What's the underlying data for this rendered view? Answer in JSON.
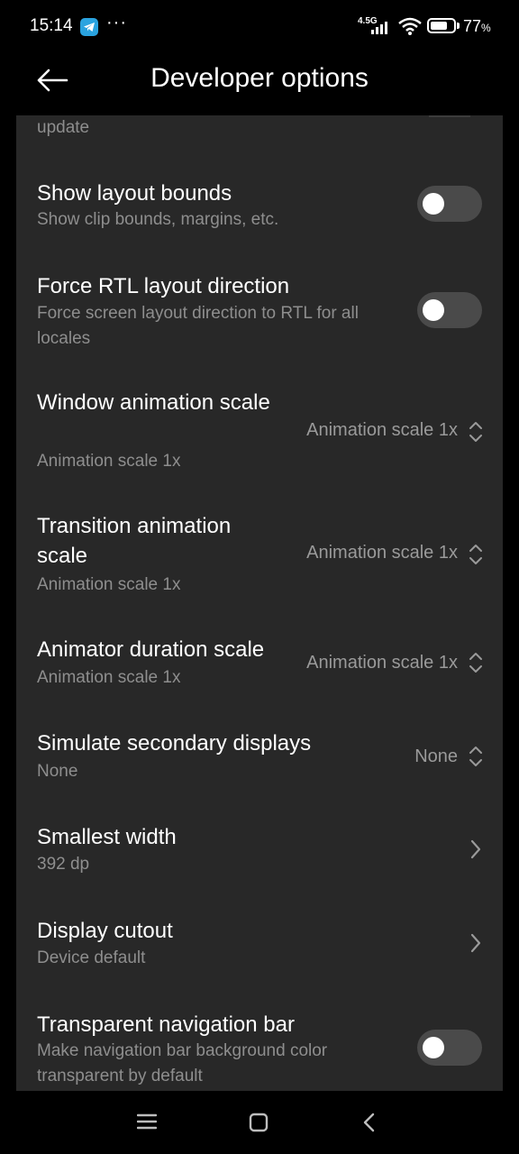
{
  "status_bar": {
    "time": "15:14",
    "more": "···",
    "network": "4.5G",
    "battery_percent": "77",
    "battery_unit": "%",
    "battery_level": 0.77
  },
  "header": {
    "title": "Developer options",
    "back_icon": "back-arrow-icon"
  },
  "settings": {
    "partial_item": {
      "subtitle": "update"
    },
    "items": [
      {
        "title": "Show layout bounds",
        "subtitle": "Show clip bounds, margins, etc.",
        "control": "toggle",
        "on": false
      },
      {
        "title": "Force RTL layout direction",
        "subtitle": "Force screen layout direction to RTL for all locales",
        "control": "toggle",
        "on": false
      },
      {
        "title": "Window animation scale",
        "subtitle": "Animation scale 1x",
        "value": "Animation scale 1x",
        "control": "select"
      },
      {
        "title": "Transition animation scale",
        "subtitle": "Animation scale 1x",
        "value": "Animation scale 1x",
        "control": "select"
      },
      {
        "title": "Animator duration scale",
        "subtitle": "Animation scale 1x",
        "value": "Animation scale 1x",
        "control": "select"
      },
      {
        "title": "Simulate secondary displays",
        "subtitle": "None",
        "value": "None",
        "control": "select"
      },
      {
        "title": "Smallest width",
        "subtitle": "392 dp",
        "control": "chevron"
      },
      {
        "title": "Display cutout",
        "subtitle": "Device default",
        "control": "chevron"
      },
      {
        "title": "Transparent navigation bar",
        "subtitle": "Make navigation bar background color transparent by default",
        "control": "toggle",
        "on": false
      }
    ]
  },
  "navbar": {
    "icons": [
      "menu-icon",
      "home-icon",
      "back-icon"
    ]
  },
  "colors": {
    "background": "#000000",
    "panel": "#282828",
    "subtitle": "#8e8e8e",
    "toggle_off": "#4a4a4a"
  }
}
